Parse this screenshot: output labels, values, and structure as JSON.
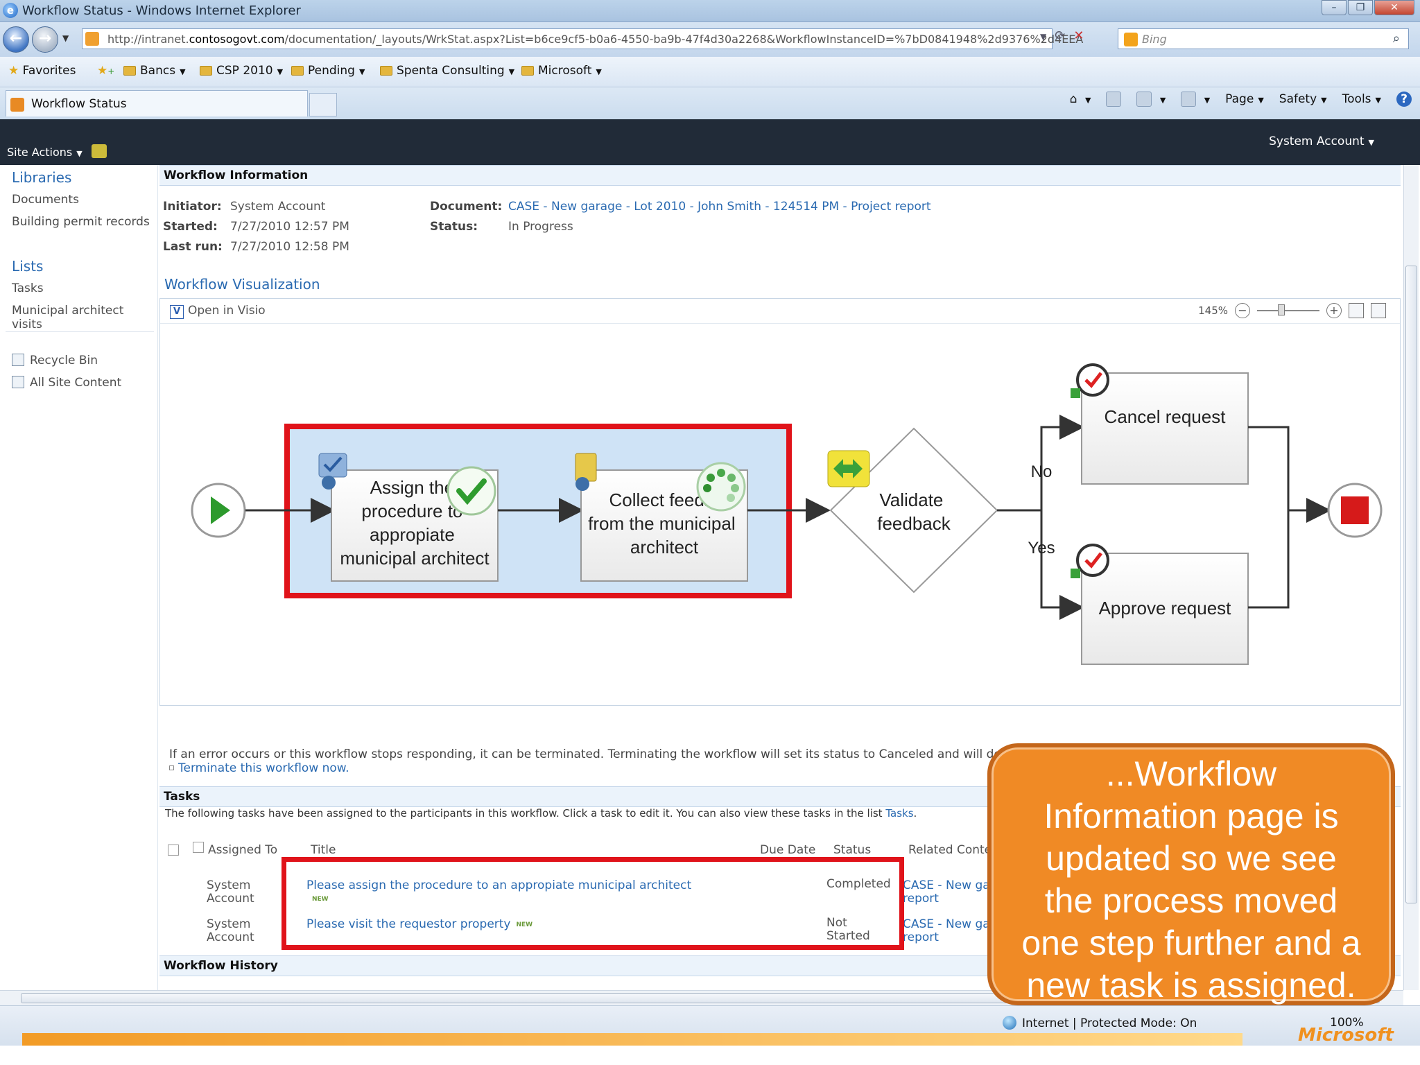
{
  "window": {
    "title": "Workflow Status - Windows Internet Explorer"
  },
  "browser": {
    "url_prefix": "http://intranet.",
    "url_domain": "contosogovt.com",
    "url_path": "/documentation/_layouts/WrkStat.aspx?List=b6ce9cf5-b0a6-4550-ba9b-47f4d30a2268&WorkflowInstanceID=%7bD0841948%2d9376%2d4EEA",
    "search_placeholder": "Bing",
    "favorites_label": "Favorites",
    "favorites": [
      "Bancs",
      "CSP 2010",
      "Pending",
      "Spenta Consulting",
      "Microsoft"
    ],
    "tab_label": "Workflow Status",
    "command_bar": {
      "page": "Page",
      "safety": "Safety",
      "tools": "Tools"
    },
    "status_zone": "Internet | Protected Mode: On",
    "status_zoom": "100%"
  },
  "sharepoint": {
    "site_actions": "Site Actions",
    "user": "System Account",
    "nav": {
      "libraries": "Libraries",
      "documents": "Documents",
      "building_permit": "Building permit records",
      "lists": "Lists",
      "tasks": "Tasks",
      "municipal": "Municipal architect visits",
      "recycle_bin": "Recycle Bin",
      "all_site_content": "All Site Content"
    }
  },
  "workflow_info": {
    "heading": "Workflow Information",
    "initiator_label": "Initiator:",
    "initiator": "System Account",
    "started_label": "Started:",
    "started": "7/27/2010 12:57 PM",
    "last_run_label": "Last run:",
    "last_run": "7/27/2010 12:58 PM",
    "document_label": "Document:",
    "document": "CASE - New garage - Lot 2010 - John Smith - 124514 PM - Project report",
    "status_label": "Status:",
    "status": "In Progress"
  },
  "visualization": {
    "heading": "Workflow Visualization",
    "open_in_visio": "Open in Visio",
    "zoom": "145%",
    "steps": {
      "assign": [
        "Assign the",
        "procedure to",
        "appropiate",
        "municipal architect"
      ],
      "collect": [
        "Collect feedb",
        "from the municipal",
        "architect"
      ],
      "validate": [
        "Validate",
        "feedback"
      ],
      "cancel": "Cancel request",
      "approve": "Approve request",
      "no": "No",
      "yes": "Yes"
    }
  },
  "error_note": "If an error occurs or this workflow stops responding, it can be terminated. Terminating the workflow will set its status to Canceled and will delet",
  "terminate_link": "Terminate this workflow now.",
  "tasks": {
    "heading": "Tasks",
    "desc_prefix": "The following tasks have been assigned to the participants in this workflow. Click a task to edit it. You can also view these tasks in the list ",
    "desc_link": "Tasks",
    "desc_suffix": ".",
    "columns": {
      "assigned_to": "Assigned To",
      "title": "Title",
      "due_date": "Due Date",
      "status": "Status",
      "related": "Related Conte"
    },
    "new_badge": "NEW",
    "rows": [
      {
        "assigned": [
          "System",
          "Account"
        ],
        "title": "Please assign the procedure to an appropiate municipal architect",
        "status": [
          "Completed",
          ""
        ],
        "related": [
          "CASE - New ga",
          "report"
        ]
      },
      {
        "assigned": [
          "System",
          "Account"
        ],
        "title": "Please visit the requestor property",
        "status": [
          "Not",
          "Started"
        ],
        "related": [
          "CASE - New ga",
          "report"
        ]
      }
    ]
  },
  "history": {
    "heading": "Workflow History"
  },
  "callout": {
    "lines": [
      "...Workflow",
      "Information page is",
      "updated so we see",
      "the process moved",
      "one step further and a",
      "new task is assigned."
    ]
  },
  "footer_brand": "Microsoft",
  "colors": {
    "highlight": "#e0131a",
    "callout": "#f08a25",
    "sp_link": "#2a6ab1",
    "sp_dark": "#212b38"
  }
}
